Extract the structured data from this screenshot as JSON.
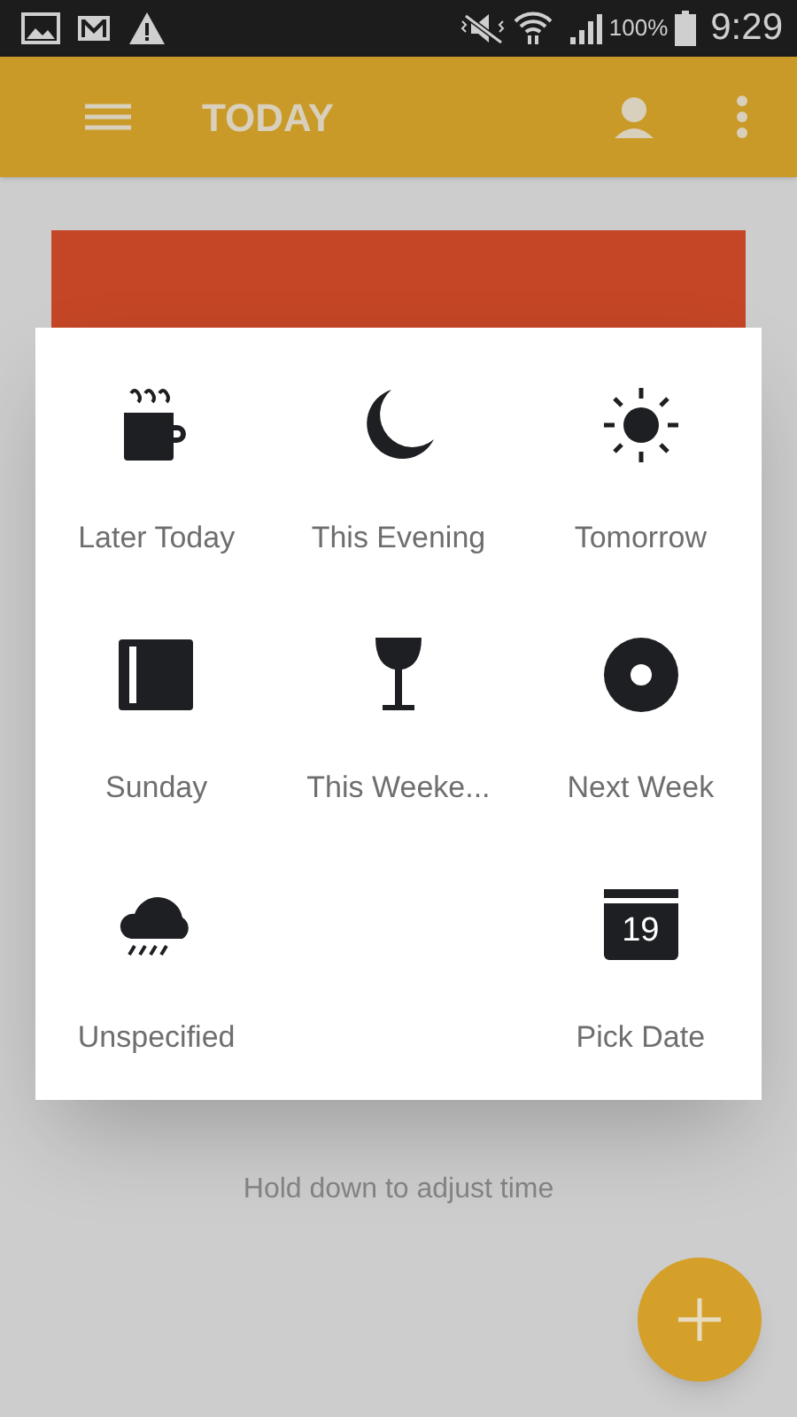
{
  "status_bar": {
    "battery": "100%",
    "time": "9:29"
  },
  "app_bar": {
    "title": "TODAY"
  },
  "snooze_options": [
    {
      "kind": "cup",
      "label": "Later Today"
    },
    {
      "kind": "moon",
      "label": "This Evening"
    },
    {
      "kind": "sun",
      "label": "Tomorrow"
    },
    {
      "kind": "notebook",
      "label": "Sunday"
    },
    {
      "kind": "glass",
      "label": "This Weeke..."
    },
    {
      "kind": "disc",
      "label": "Next Week"
    },
    {
      "kind": "rain",
      "label": "Unspecified"
    },
    {
      "kind": "calendar",
      "label": "Pick Date",
      "day": "19"
    }
  ],
  "hint": "Hold down to adjust time"
}
